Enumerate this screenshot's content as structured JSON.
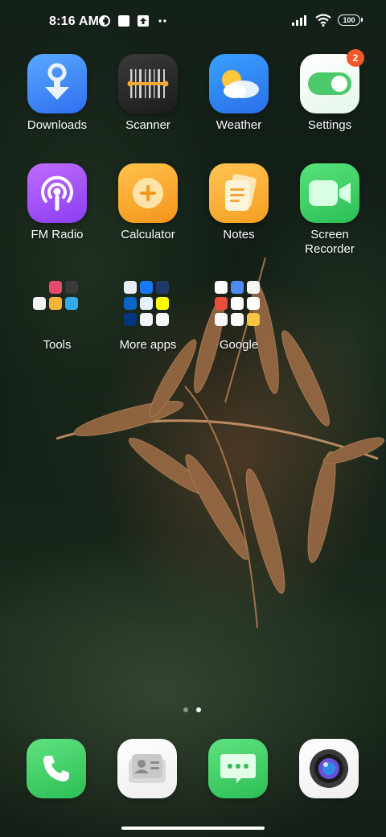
{
  "status_bar": {
    "time": "8:16 AM",
    "battery": "100",
    "left_icons": [
      "status-circle-icon",
      "square-notification-icon",
      "upload-notification-icon",
      "more-dots-icon"
    ],
    "right_icons": [
      "signal-icon",
      "wifi-icon",
      "battery-icon"
    ]
  },
  "apps": [
    {
      "label": "Downloads",
      "icon": "download-icon"
    },
    {
      "label": "Scanner",
      "icon": "scanner-icon"
    },
    {
      "label": "Weather",
      "icon": "weather-icon"
    },
    {
      "label": "Settings",
      "icon": "toggle-icon",
      "badge": "2"
    },
    {
      "label": "FM Radio",
      "icon": "radio-icon"
    },
    {
      "label": "Calculator",
      "icon": "calculator-icon"
    },
    {
      "label": "Notes",
      "icon": "notes-icon"
    },
    {
      "label": "Screen\nRecorder",
      "icon": "video-camera-icon"
    }
  ],
  "folders": [
    {
      "label": "Tools"
    },
    {
      "label": "More apps"
    },
    {
      "label": "Google"
    }
  ],
  "page_indicator": {
    "count": 2,
    "active": 2
  },
  "dock": [
    {
      "name": "phone",
      "icon": "phone-icon"
    },
    {
      "name": "contacts",
      "icon": "contact-card-icon"
    },
    {
      "name": "messages",
      "icon": "message-icon"
    },
    {
      "name": "camera",
      "icon": "camera-lens-icon"
    }
  ]
}
